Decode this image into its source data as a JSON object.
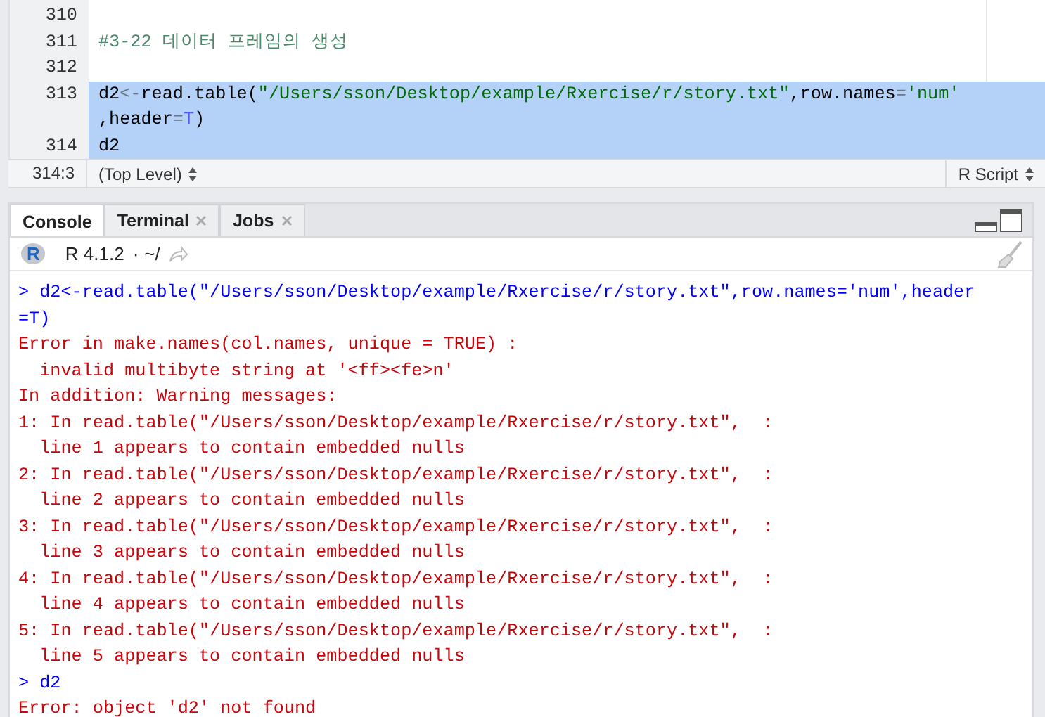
{
  "editor": {
    "lines": [
      {
        "number": "310",
        "selected": false
      },
      {
        "number": "311",
        "selected": false,
        "visual_lines": [
          {
            "tokens": [
              {
                "kind": "comment",
                "text": "#3-22 데이터 프레임의 생성"
              }
            ]
          }
        ]
      },
      {
        "number": "312",
        "selected": false
      },
      {
        "number": "313",
        "selected": true,
        "visual_lines": [
          {
            "tokens": [
              {
                "kind": "plain",
                "text": "d2"
              },
              {
                "kind": "operator",
                "text": "<-"
              },
              {
                "kind": "plain",
                "text": "read.table("
              },
              {
                "kind": "string",
                "text": "\"/Users/sson/Desktop/example/Rxercise/r/story.txt\""
              },
              {
                "kind": "plain",
                "text": ",row.names"
              },
              {
                "kind": "operator",
                "text": "="
              },
              {
                "kind": "string",
                "text": "'num'"
              }
            ]
          },
          {
            "tokens": [
              {
                "kind": "plain",
                "text": ",header"
              },
              {
                "kind": "operator",
                "text": "="
              },
              {
                "kind": "constant",
                "text": "T"
              },
              {
                "kind": "plain",
                "text": ")"
              }
            ]
          }
        ]
      },
      {
        "number": "314",
        "selected": true,
        "visual_lines": [
          {
            "tokens": [
              {
                "kind": "plain",
                "text": "d2"
              }
            ]
          }
        ]
      }
    ]
  },
  "status_bar": {
    "position": "314:3",
    "scope": "(Top Level)",
    "file_type": "R Script"
  },
  "tabs": [
    {
      "label": "Console",
      "selected": true,
      "closable": false
    },
    {
      "label": "Terminal",
      "selected": false,
      "closable": true
    },
    {
      "label": "Jobs",
      "selected": false,
      "closable": true
    }
  ],
  "console_toolbar": {
    "logo": "R",
    "version": "R 4.1.2",
    "separator": "·",
    "path": "~/"
  },
  "console": [
    {
      "kind": "input",
      "text": "> d2<-read.table(\"/Users/sson/Desktop/example/Rxercise/r/story.txt\",row.names='num',header"
    },
    {
      "kind": "input",
      "text": "=T)"
    },
    {
      "kind": "error",
      "text": "Error in make.names(col.names, unique = TRUE) :"
    },
    {
      "kind": "error",
      "text": "  invalid multibyte string at '<ff><fe>n'"
    },
    {
      "kind": "error",
      "text": "In addition: Warning messages:"
    },
    {
      "kind": "error",
      "text": "1: In read.table(\"/Users/sson/Desktop/example/Rxercise/r/story.txt\",  :"
    },
    {
      "kind": "error",
      "text": "  line 1 appears to contain embedded nulls"
    },
    {
      "kind": "error",
      "text": "2: In read.table(\"/Users/sson/Desktop/example/Rxercise/r/story.txt\",  :"
    },
    {
      "kind": "error",
      "text": "  line 2 appears to contain embedded nulls"
    },
    {
      "kind": "error",
      "text": "3: In read.table(\"/Users/sson/Desktop/example/Rxercise/r/story.txt\",  :"
    },
    {
      "kind": "error",
      "text": "  line 3 appears to contain embedded nulls"
    },
    {
      "kind": "error",
      "text": "4: In read.table(\"/Users/sson/Desktop/example/Rxercise/r/story.txt\",  :"
    },
    {
      "kind": "error",
      "text": "  line 4 appears to contain embedded nulls"
    },
    {
      "kind": "error",
      "text": "5: In read.table(\"/Users/sson/Desktop/example/Rxercise/r/story.txt\",  :"
    },
    {
      "kind": "error",
      "text": "  line 5 appears to contain embedded nulls"
    },
    {
      "kind": "input",
      "text": "> d2"
    },
    {
      "kind": "error",
      "text": "Error: object 'd2' not found"
    }
  ]
}
